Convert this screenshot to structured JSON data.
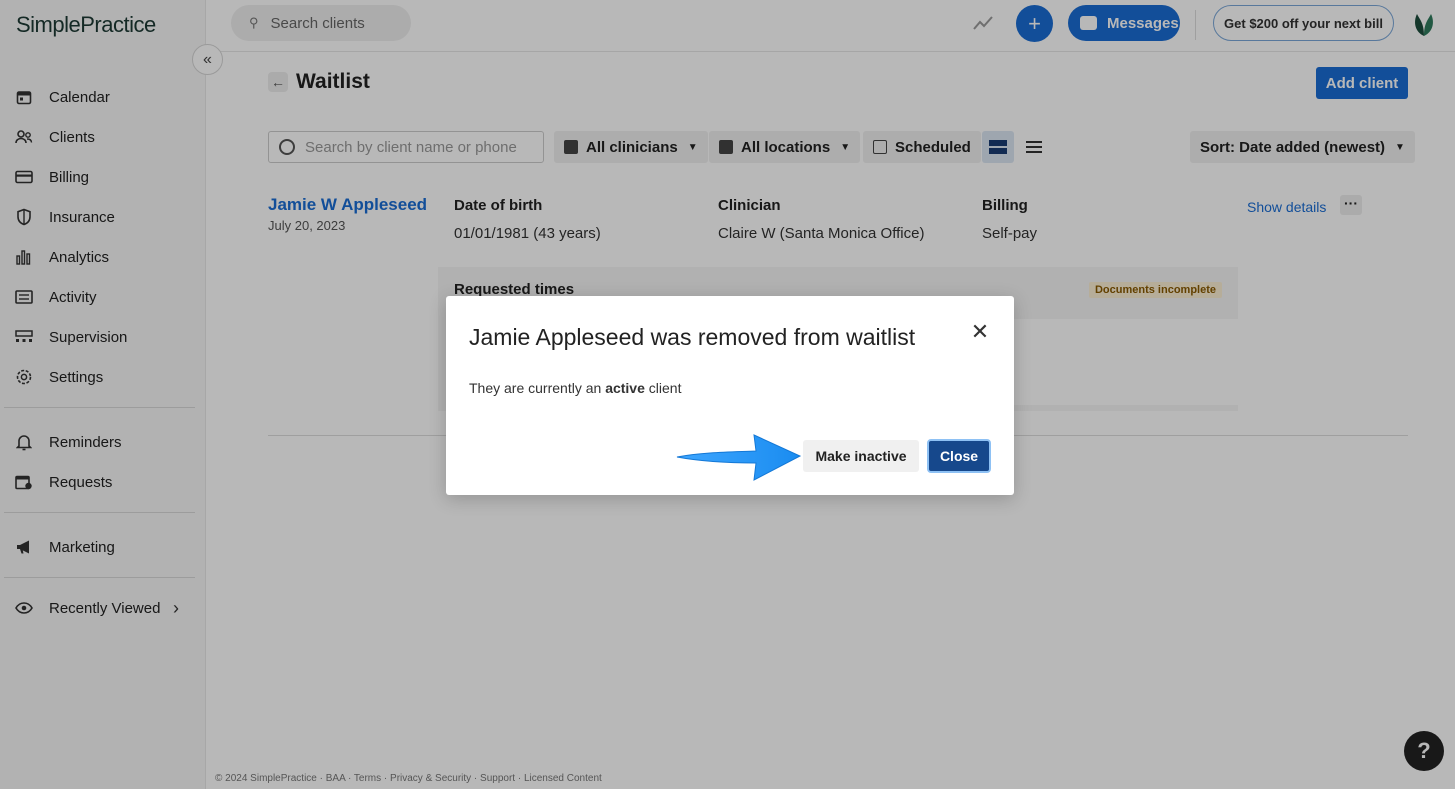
{
  "app": {
    "logo": "SimplePractice"
  },
  "sidebar": {
    "items": [
      {
        "label": "Calendar",
        "icon": "calendar-icon"
      },
      {
        "label": "Clients",
        "icon": "clients-icon"
      },
      {
        "label": "Billing",
        "icon": "billing-icon"
      },
      {
        "label": "Insurance",
        "icon": "shield-icon"
      },
      {
        "label": "Analytics",
        "icon": "analytics-icon"
      },
      {
        "label": "Activity",
        "icon": "activity-icon"
      },
      {
        "label": "Supervision",
        "icon": "supervision-icon"
      },
      {
        "label": "Settings",
        "icon": "gear-icon"
      },
      {
        "label": "Reminders",
        "icon": "bell-icon"
      },
      {
        "label": "Requests",
        "icon": "requests-icon"
      },
      {
        "label": "Marketing",
        "icon": "megaphone-icon"
      },
      {
        "label": "Recently Viewed",
        "icon": "eye-icon"
      }
    ]
  },
  "topbar": {
    "search_placeholder": "Search clients",
    "messages_label": "Messages",
    "promo_label": "Get $200 off your next bill",
    "accent": "#1a6dd4"
  },
  "page": {
    "title": "Waitlist",
    "add_client_label": "Add client",
    "filters": {
      "search_placeholder": "Search by client name or phone",
      "clinicians": "All clinicians",
      "locations": "All locations",
      "scheduled": "Scheduled",
      "sort": "Sort: Date added (newest)"
    }
  },
  "client": {
    "name": "Jamie W Appleseed",
    "date_added": "July 20, 2023",
    "dob_header": "Date of birth",
    "dob_value": "01/01/1981 (43 years)",
    "clinician_header": "Clinician",
    "clinician_value": "Claire W (Santa Monica Office)",
    "billing_header": "Billing",
    "billing_value": "Self-pay",
    "show_details": "Show details",
    "requested_times": "Requested times",
    "documents_badge": "Documents incomplete"
  },
  "modal": {
    "title": "Jamie Appleseed was removed from waitlist",
    "body_prefix": "They are currently an",
    "body_bold": "active",
    "body_suffix": "client",
    "make_inactive_label": "Make inactive",
    "close_label": "Close"
  },
  "footer": {
    "text": "© 2024 SimplePractice · BAA · Terms · Privacy & Security · Support · Licensed Content"
  },
  "help": {
    "label": "?"
  }
}
